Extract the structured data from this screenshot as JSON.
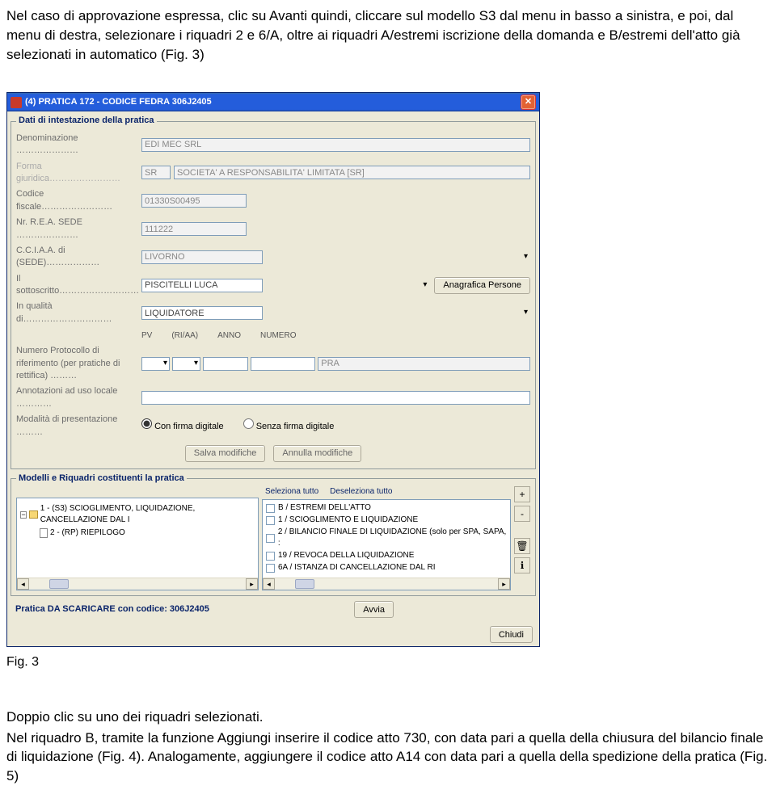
{
  "intro": {
    "p1": "Nel caso di approvazione espressa, clic su Avanti quindi, cliccare sul modello S3 dal menu in basso a sinistra, e poi, dal menu di destra, selezionare i riquadri 2 e 6/A, oltre ai riquadri A/estremi iscrizione della domanda e  B/estremi dell'atto già selezionati in automatico (Fig. 3)"
  },
  "window": {
    "title": "(4) PRATICA 172 - CODICE FEDRA 306J2405"
  },
  "group1": {
    "legend": "Dati di intestazione della pratica",
    "labels": {
      "denominazione": "Denominazione …………………",
      "forma": "Forma giuridica……………………",
      "codfisc": "Codice fiscale……………………",
      "rea": "Nr. R.E.A. SEDE …………………",
      "ccia": "C.C.I.A.A. di (SEDE)………………",
      "sotto": "Il sottoscritto………………………",
      "qualita": "In qualità di…………………………",
      "proto": "Numero Protocollo di riferimento (per pratiche di rettifica) ………",
      "annot": "Annotazioni ad  uso locale …………",
      "present": "Modalità di presentazione ………"
    },
    "fields": {
      "denominazione": "EDI MEC SRL",
      "forma_code": "SR",
      "forma_desc": "SOCIETA' A RESPONSABILITA' LIMITATA [SR]",
      "codfisc": "01330S00495",
      "rea": "111222",
      "ccia": "LIVORNO",
      "sotto": "PISCITELLI LUCA",
      "qualita": "LIQUIDATORE",
      "proto_empty": "",
      "pra": "PRA",
      "annot": ""
    },
    "proto_headers": {
      "pv": "PV",
      "ri": "(RI/AA)",
      "anno": "ANNO",
      "num": "NUMERO"
    },
    "radios": {
      "digital": "Con firma digitale",
      "nodigital": "Senza firma digitale"
    },
    "buttons": {
      "anag": "Anagrafica Persone",
      "salva": "Salva modifiche",
      "annulla": "Annulla modifiche"
    }
  },
  "group2": {
    "legend": "Modelli e Riquadri costituenti la pratica",
    "sel_links": {
      "all": "Seleziona tutto",
      "none": "Deseleziona tutto"
    },
    "tree": {
      "item1": "1 - (S3) SCIOGLIMENTO, LIQUIDAZIONE, CANCELLAZIONE DAL I",
      "item2": "2 - (RP) RIEPILOGO"
    },
    "list": {
      "r1": "B / ESTREMI DELL'ATTO",
      "r2": "1 / SCIOGLIMENTO E LIQUIDAZIONE",
      "r3": "2 / BILANCIO FINALE DI LIQUIDAZIONE  (solo per SPA, SAPA, :",
      "r4": "19 / REVOCA DELLA LIQUIDAZIONE",
      "r5": "6A / ISTANZA DI CANCELLAZIONE DAL RI"
    },
    "side": {
      "plus": "+",
      "minus": "-",
      "trash": "🗑",
      "info": "ℹ"
    }
  },
  "group3": {
    "label": "Pratica DA SCARICARE con codice: 306J2405",
    "avvia": "Avvia"
  },
  "buttons": {
    "chiudi": "Chiudi"
  },
  "fig_label": "Fig. 3",
  "outro": {
    "p1": "Doppio clic su uno dei riquadri selezionati.",
    "p2": "Nel riquadro B, tramite la funzione Aggiungi inserire il codice atto 730, con data pari a quella della chiusura del bilancio finale di liquidazione (Fig. 4). Analogamente, aggiungere il codice atto A14 con data pari a quella della spedizione della pratica (Fig. 5)"
  }
}
